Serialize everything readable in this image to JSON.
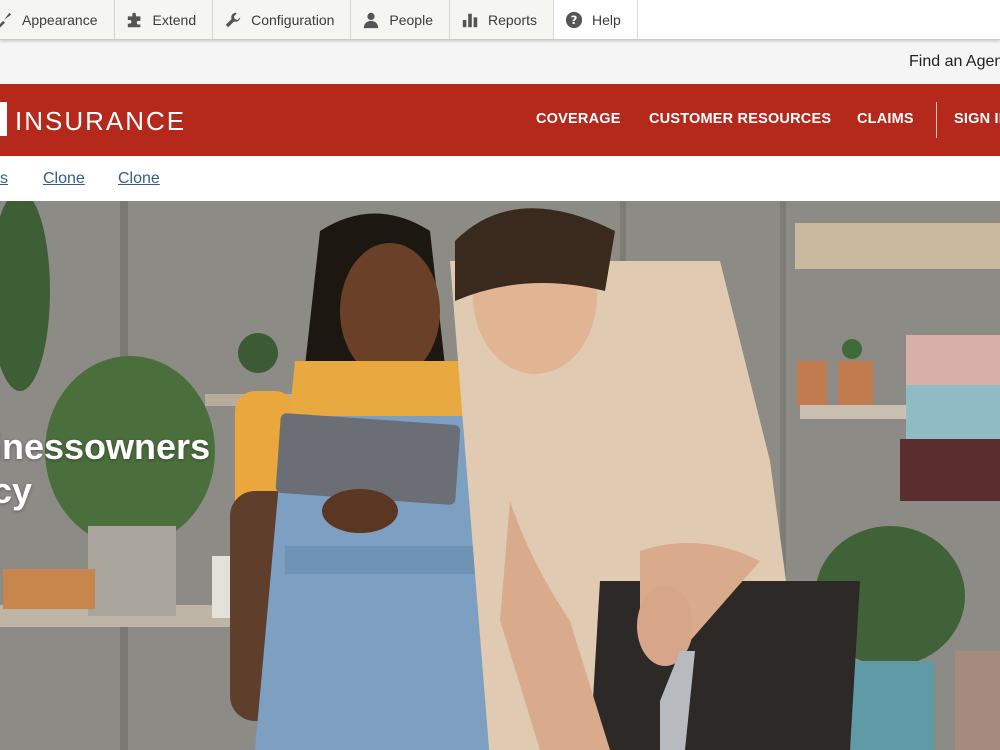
{
  "admin_toolbar": {
    "items": [
      {
        "label": "Appearance",
        "icon": "paintbrush-icon"
      },
      {
        "label": "Extend",
        "icon": "puzzle-icon"
      },
      {
        "label": "Configuration",
        "icon": "wrench-icon"
      },
      {
        "label": "People",
        "icon": "person-icon"
      },
      {
        "label": "Reports",
        "icon": "bar-chart-icon"
      },
      {
        "label": "Help",
        "icon": "help-circle-icon"
      }
    ]
  },
  "utility": {
    "find_agent": "Find an Agen"
  },
  "brand": {
    "name": "INSURANCE",
    "color": "#b5291d",
    "nav": [
      "COVERAGE",
      "CUSTOMER RESOURCES",
      "CLAIMS",
      "SIGN IN"
    ]
  },
  "local_tabs": [
    "s",
    "Clone",
    "Clone"
  ],
  "hero": {
    "title": "inessowners\ncy",
    "image": "photo-two-people-tablet-plant-shop"
  }
}
